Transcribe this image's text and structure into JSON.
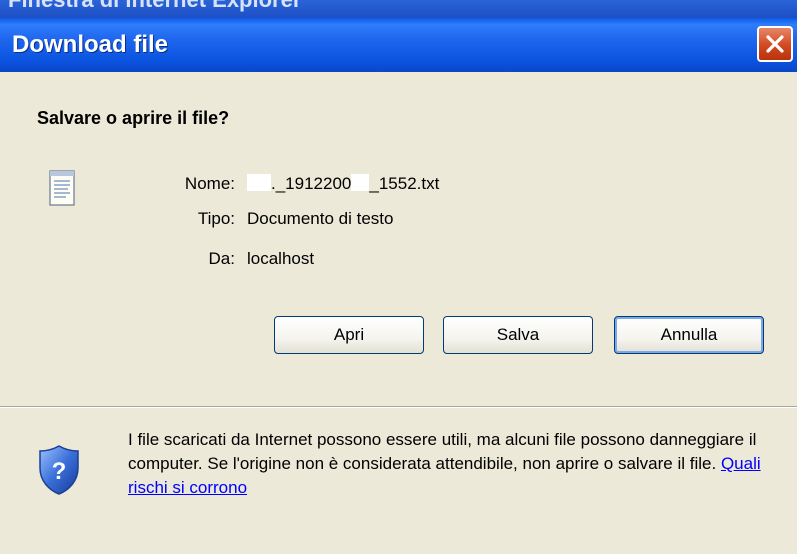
{
  "background_window": {
    "title_fragment": "Finestra di Internet Explorer"
  },
  "dialog": {
    "title": "Download file",
    "question": "Salvare o aprire il file?",
    "file": {
      "name_label": "Nome:",
      "name_prefix": "._1912200",
      "name_suffix": "_1552.txt",
      "type_label": "Tipo:",
      "type_value": "Documento di testo",
      "from_label": "Da:",
      "from_value": "localhost"
    },
    "buttons": {
      "open": "Apri",
      "save": "Salva",
      "cancel": "Annulla"
    },
    "warning": {
      "text": "I file scaricati da Internet possono essere utili, ma alcuni file possono danneggiare il computer. Se l'origine non è considerata attendibile, non aprire o salvare il file.",
      "link": "Quali rischi si corrono"
    }
  },
  "colors": {
    "titlebar": "#0a53df",
    "dialog_bg": "#ECE9D8",
    "close_button": "#d2491f",
    "link": "#0000ff"
  },
  "icons": [
    "close-icon",
    "text-file-icon",
    "security-shield-icon"
  ]
}
